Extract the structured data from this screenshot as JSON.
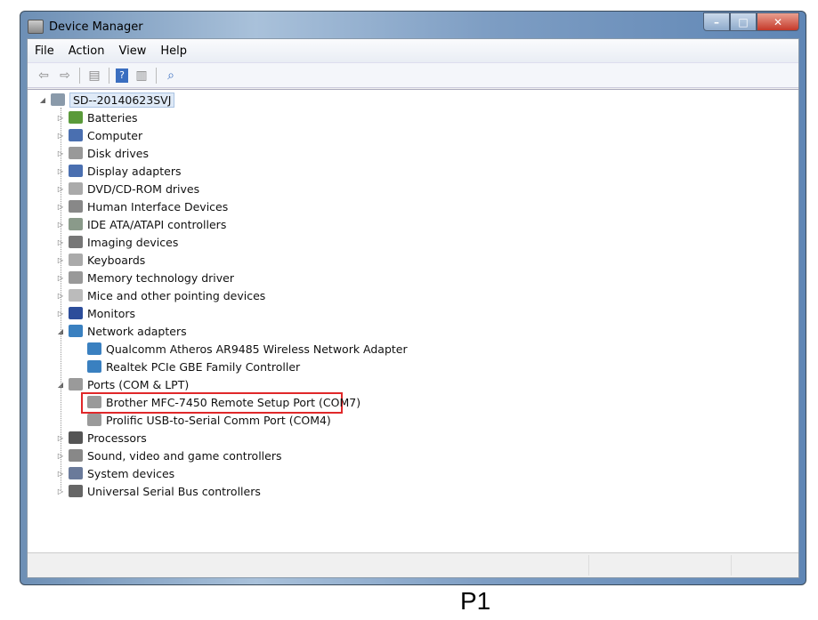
{
  "window": {
    "title": "Device Manager",
    "minimize": "–",
    "maximize": "□",
    "close": "✕"
  },
  "menu": [
    "File",
    "Action",
    "View",
    "Help"
  ],
  "toolbar": [
    "back-icon",
    "forward-icon",
    "show-hide-console-tree-icon",
    "help-icon",
    "show-hide-action-pane-icon",
    "scan-hardware-icon"
  ],
  "tree": {
    "root": "SD--20140623SVJ",
    "items": [
      {
        "label": "Batteries",
        "icon": "battery-icon",
        "state": "collapsed",
        "color": "#5a9a3a"
      },
      {
        "label": "Computer",
        "icon": "computer-icon",
        "state": "collapsed",
        "color": "#4a6fb0"
      },
      {
        "label": "Disk drives",
        "icon": "disk-drive-icon",
        "state": "collapsed",
        "color": "#999"
      },
      {
        "label": "Display adapters",
        "icon": "display-adapter-icon",
        "state": "collapsed",
        "color": "#4a6fb0"
      },
      {
        "label": "DVD/CD-ROM drives",
        "icon": "dvd-drive-icon",
        "state": "collapsed",
        "color": "#aaa"
      },
      {
        "label": "Human Interface Devices",
        "icon": "hid-icon",
        "state": "collapsed",
        "color": "#888"
      },
      {
        "label": "IDE ATA/ATAPI controllers",
        "icon": "ide-controller-icon",
        "state": "collapsed",
        "color": "#8a9a8a"
      },
      {
        "label": "Imaging devices",
        "icon": "imaging-device-icon",
        "state": "collapsed",
        "color": "#777"
      },
      {
        "label": "Keyboards",
        "icon": "keyboard-icon",
        "state": "collapsed",
        "color": "#aaa"
      },
      {
        "label": "Memory technology driver",
        "icon": "memory-icon",
        "state": "collapsed",
        "color": "#999"
      },
      {
        "label": "Mice and other pointing devices",
        "icon": "mouse-icon",
        "state": "collapsed",
        "color": "#bbb"
      },
      {
        "label": "Monitors",
        "icon": "monitor-icon",
        "state": "collapsed",
        "color": "#2c4d9a"
      },
      {
        "label": "Network adapters",
        "icon": "network-adapter-icon",
        "state": "expanded",
        "color": "#3a80c0",
        "children": [
          {
            "label": "Qualcomm Atheros AR9485 Wireless Network Adapter",
            "icon": "network-adapter-icon",
            "color": "#3a80c0"
          },
          {
            "label": "Realtek PCIe GBE Family Controller",
            "icon": "network-adapter-icon",
            "color": "#3a80c0"
          }
        ]
      },
      {
        "label": "Ports (COM & LPT)",
        "icon": "port-icon",
        "state": "expanded",
        "color": "#9a9a9a",
        "children": [
          {
            "label": "Brother MFC-7450 Remote Setup Port (COM7)",
            "icon": "port-icon",
            "color": "#9a9a9a"
          },
          {
            "label": "Prolific USB-to-Serial Comm Port (COM4)",
            "icon": "port-icon",
            "color": "#9a9a9a",
            "highlighted": true
          }
        ]
      },
      {
        "label": "Processors",
        "icon": "processor-icon",
        "state": "collapsed",
        "color": "#555"
      },
      {
        "label": "Sound, video and game controllers",
        "icon": "speaker-icon",
        "state": "collapsed",
        "color": "#888"
      },
      {
        "label": "System devices",
        "icon": "system-device-icon",
        "state": "collapsed",
        "color": "#6a7a9a"
      },
      {
        "label": "Universal Serial Bus controllers",
        "icon": "usb-icon",
        "state": "collapsed",
        "color": "#666"
      }
    ]
  },
  "caption": "P1"
}
